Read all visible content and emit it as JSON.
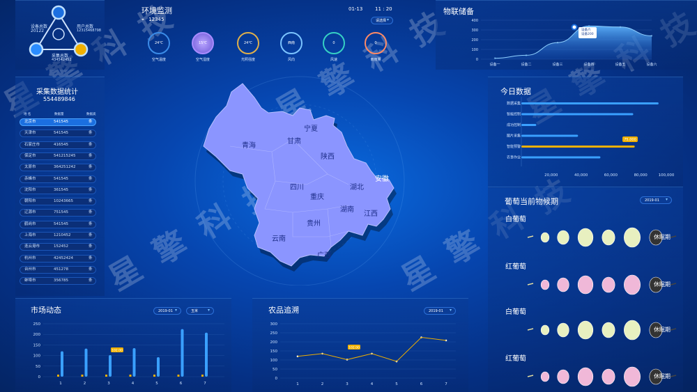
{
  "top_left": {
    "device_total_label": "设备总数",
    "device_total": "20122",
    "user_total_label": "用户总数",
    "user_total": "12315468798",
    "collect_total_label": "采集总数",
    "collect_total": "434542452"
  },
  "env": {
    "title": "环境监测",
    "location_value": "12345",
    "date": "01-13",
    "time": "11 : 20",
    "select_placeholder": "请选择",
    "sensors": [
      {
        "value": "24℃",
        "label": "空气温度",
        "color": "#3b8ce8"
      },
      {
        "value": "15℃",
        "label": "空气湿度",
        "color": "#a98cff"
      },
      {
        "value": "24℃",
        "label": "光照强度",
        "color": "#e0b04a"
      },
      {
        "value": "西南",
        "label": "风向",
        "color": "#7cc4ff"
      },
      {
        "value": "0",
        "label": "风速",
        "color": "#36d1c4"
      },
      {
        "value": "0",
        "label": "雨雨量",
        "color": "#ff8a66"
      }
    ]
  },
  "iot": {
    "title": "物联储备",
    "tooltip_line1": "设备六",
    "tooltip_line2": "设备200",
    "chart_data": {
      "type": "area",
      "categories": [
        "设备一",
        "设备二",
        "设备三",
        "设备四",
        "设备五",
        "设备六"
      ],
      "values": [
        10,
        40,
        170,
        340,
        330,
        240
      ],
      "ylim": [
        0,
        400
      ],
      "yticks": [
        "400",
        "300",
        "200",
        "100",
        "0"
      ]
    }
  },
  "collect_stats": {
    "title": "采集数据统计",
    "total": "554489846",
    "headers": [
      "地 名",
      "数据量",
      "数据类"
    ],
    "rows": [
      {
        "city": "北京市",
        "value": "541545",
        "tag": "条"
      },
      {
        "city": "天津市",
        "value": "541545",
        "tag": "条"
      },
      {
        "city": "石家庄市",
        "value": "416545",
        "tag": "条"
      },
      {
        "city": "保定市",
        "value": "541215245",
        "tag": "条"
      },
      {
        "city": "太原市",
        "value": "364251242",
        "tag": "条"
      },
      {
        "city": "赤峰市",
        "value": "541545",
        "tag": "条"
      },
      {
        "city": "沈阳市",
        "value": "361545",
        "tag": "条"
      },
      {
        "city": "朝阳市",
        "value": "10243665",
        "tag": "条"
      },
      {
        "city": "辽源市",
        "value": "751545",
        "tag": "条"
      },
      {
        "city": "鹤岗市",
        "value": "541545",
        "tag": "条"
      },
      {
        "city": "上海市",
        "value": "1210452",
        "tag": "条"
      },
      {
        "city": "连云港市",
        "value": "152452",
        "tag": "条"
      },
      {
        "city": "杭州市",
        "value": "42452424",
        "tag": "条"
      },
      {
        "city": "台州市",
        "value": "451278",
        "tag": "条"
      },
      {
        "city": "蚌埠市",
        "value": "356785",
        "tag": "条"
      }
    ]
  },
  "map": {
    "provinces": [
      "青海",
      "甘肃",
      "宁夏",
      "陕西",
      "四川",
      "重庆",
      "湖北",
      "安徽",
      "湖南",
      "江西",
      "贵州",
      "云南",
      "广西"
    ]
  },
  "today": {
    "title": "今日数据",
    "badge": "75,000",
    "chart_data": {
      "type": "bar",
      "categories": [
        "数据采集",
        "智能控制",
        "成功控制",
        "图片采集",
        "智能预警",
        "农事作业"
      ],
      "values": [
        92000,
        75000,
        10000,
        38000,
        76000,
        53000
      ],
      "xlim": [
        0,
        100000
      ],
      "xticks": [
        "20,000",
        "40,000",
        "60,000",
        "80,000",
        "100,000"
      ]
    }
  },
  "phenology": {
    "title": "葡萄当前物候期",
    "select_value": "2019-01",
    "groups": [
      {
        "name": "白葡萄",
        "stage": "休眠期",
        "tint": "#e8f0c0"
      },
      {
        "name": "红葡萄",
        "stage": "休眠期",
        "tint": "#f0b8d8"
      },
      {
        "name": "白葡萄",
        "stage": "休眠期",
        "tint": "#e8f0c0"
      },
      {
        "name": "红葡萄",
        "stage": "休眠期",
        "tint": "#f0b8d8"
      }
    ]
  },
  "market": {
    "title": "市场动态",
    "select1": "2019-01",
    "select2": "玉米",
    "badge": "102.00",
    "chart_data": {
      "type": "bar",
      "categories": [
        "1",
        "2",
        "3",
        "4",
        "5",
        "6",
        "7"
      ],
      "values": [
        120,
        133,
        102,
        135,
        92,
        225,
        208
      ],
      "ylim": [
        0,
        250
      ],
      "yticks": [
        "250",
        "200",
        "150",
        "100",
        "50",
        "0"
      ]
    }
  },
  "trace": {
    "title": "农品追溯",
    "select1": "2019-01",
    "badge": "102.00",
    "chart_data": {
      "type": "line",
      "categories": [
        "1",
        "2",
        "3",
        "4",
        "5",
        "6",
        "7"
      ],
      "values": [
        120,
        135,
        102,
        135,
        92,
        225,
        208
      ],
      "ylim": [
        0,
        300
      ],
      "yticks": [
        "300",
        "250",
        "200",
        "150",
        "100",
        "50",
        "0"
      ]
    }
  },
  "watermark": "星 擎 科 技"
}
